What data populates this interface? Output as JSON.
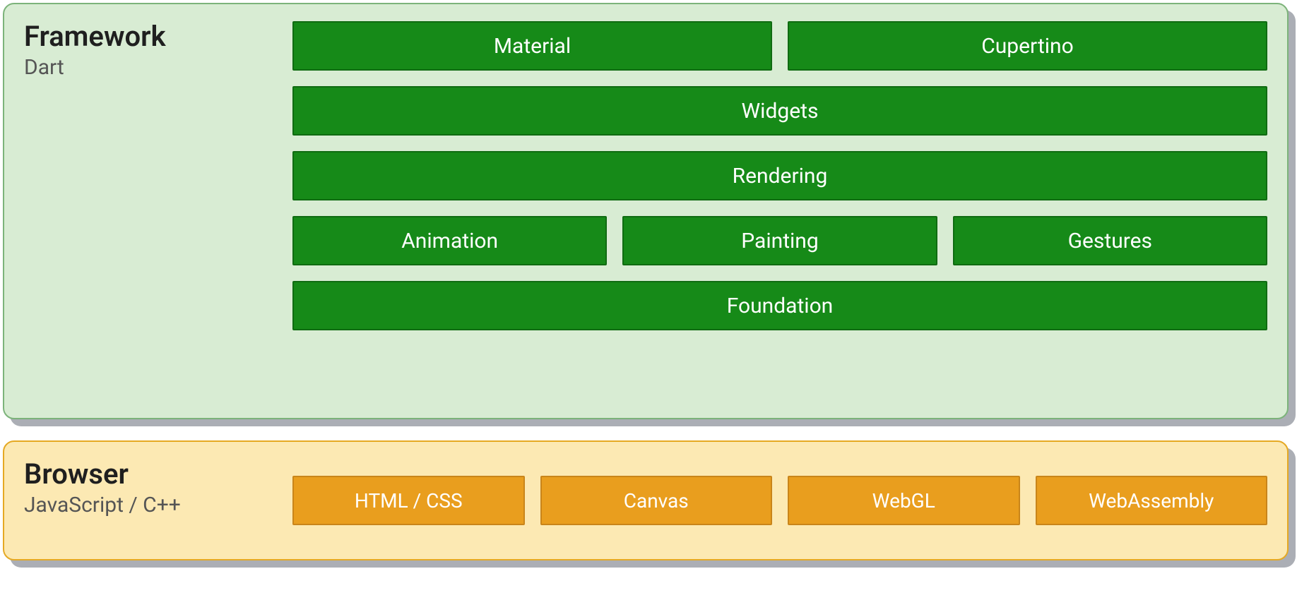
{
  "framework": {
    "title": "Framework",
    "subtitle": "Dart",
    "rows": [
      [
        "Material",
        "Cupertino"
      ],
      [
        "Widgets"
      ],
      [
        "Rendering"
      ],
      [
        "Animation",
        "Painting",
        "Gestures"
      ],
      [
        "Foundation"
      ]
    ]
  },
  "browser": {
    "title": "Browser",
    "subtitle": "JavaScript / C++",
    "rows": [
      [
        "HTML / CSS",
        "Canvas",
        "WebGL",
        "WebAssembly"
      ]
    ]
  },
  "colors": {
    "framework_bg": "#d8ecd3",
    "framework_border": "#7cb37a",
    "framework_block": "#168a18",
    "browser_bg": "#fce9b3",
    "browser_border": "#e5a924",
    "browser_block": "#e99e1e"
  }
}
